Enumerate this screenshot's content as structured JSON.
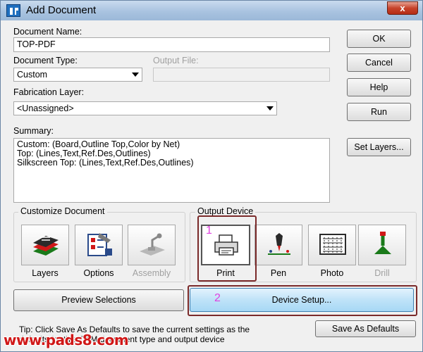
{
  "window": {
    "title": "Add Document",
    "close_label": "x"
  },
  "document_name": {
    "label": "Document Name:",
    "value": "TOP-PDF"
  },
  "document_type": {
    "label": "Document Type:",
    "value": "Custom"
  },
  "output_file": {
    "label": "Output File:",
    "value": ""
  },
  "fabrication_layer": {
    "label": "Fabrication Layer:",
    "value": "<Unassigned>"
  },
  "summary": {
    "label": "Summary:",
    "lines": [
      "Custom: (Board,Outline Top,Color by Net)",
      "Top: (Lines,Text,Ref.Des,Outlines)",
      "Silkscreen Top: (Lines,Text,Ref.Des,Outlines)"
    ]
  },
  "buttons": {
    "ok": "OK",
    "cancel": "Cancel",
    "help": "Help",
    "run": "Run",
    "set_layers": "Set Layers...",
    "preview_selections": "Preview Selections",
    "device_setup": "Device Setup...",
    "save_as_defaults": "Save As Defaults"
  },
  "customize_document": {
    "title": "Customize Document",
    "items": [
      {
        "label": "Layers",
        "icon": "layers-icon",
        "enabled": true
      },
      {
        "label": "Options",
        "icon": "options-icon",
        "enabled": true
      },
      {
        "label": "Assembly",
        "icon": "assembly-icon",
        "enabled": false
      }
    ]
  },
  "output_device": {
    "title": "Output Device",
    "items": [
      {
        "label": "Print",
        "icon": "printer-icon",
        "enabled": true,
        "selected": true
      },
      {
        "label": "Pen",
        "icon": "pen-plotter-icon",
        "enabled": true
      },
      {
        "label": "Photo",
        "icon": "photo-plotter-icon",
        "enabled": true
      },
      {
        "label": "Drill",
        "icon": "drill-icon",
        "enabled": false
      }
    ]
  },
  "annotations": {
    "marker_1": "1",
    "marker_2": "2"
  },
  "tip": {
    "line1": "Tip: Click Save As Defaults to save the current settings as the",
    "line2": "defaults for this CAM document type and output device"
  },
  "watermark": "www.pads8.com",
  "colors": {
    "highlight_border": "#7a2a2a",
    "marker_text": "#e040e0",
    "device_setup_fill": "#bfe3f8",
    "watermark": "#d01818"
  }
}
